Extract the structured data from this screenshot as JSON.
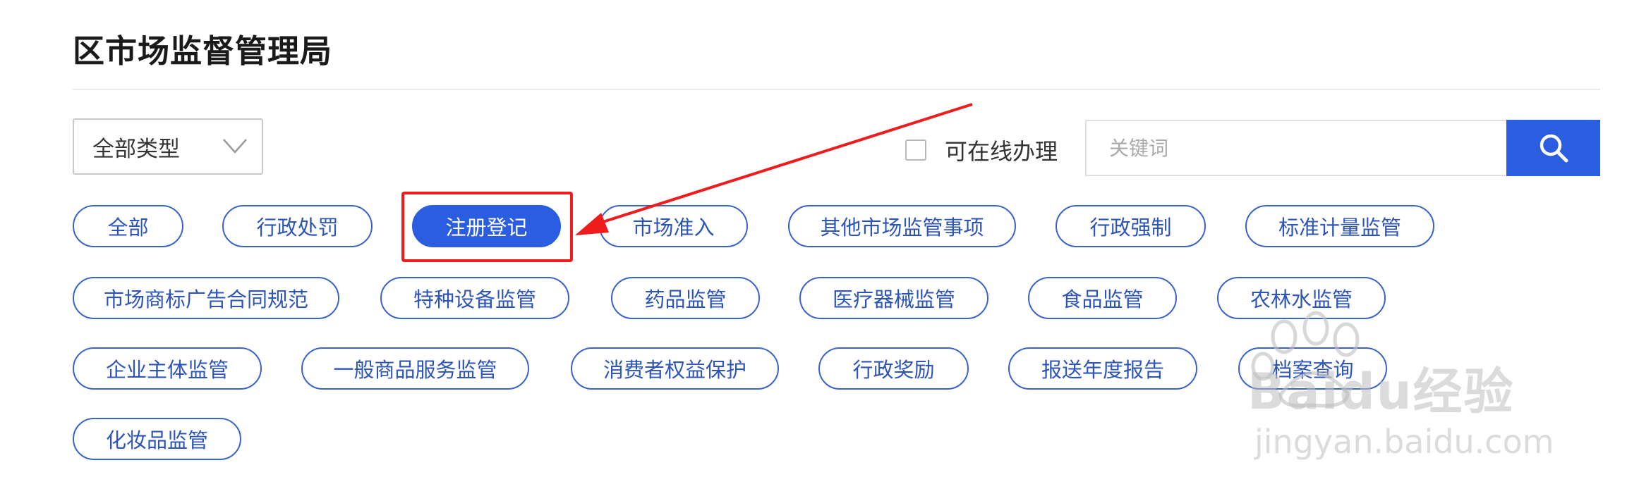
{
  "header": {
    "title": "区市场监督管理局"
  },
  "filters": {
    "type_select": {
      "value": "全部类型"
    },
    "online_checkbox": {
      "label": "可在线办理",
      "checked": false
    },
    "search": {
      "placeholder": "关键词"
    }
  },
  "categories": [
    {
      "label": "全部"
    },
    {
      "label": "行政处罚"
    },
    {
      "label": "注册登记",
      "active": true
    },
    {
      "label": "市场准入"
    },
    {
      "label": "其他市场监管事项"
    },
    {
      "label": "行政强制"
    },
    {
      "label": "标准计量监管"
    },
    {
      "label": "市场商标广告合同规范"
    },
    {
      "label": "特种设备监管"
    },
    {
      "label": "药品监管"
    },
    {
      "label": "医疗器械监管"
    },
    {
      "label": "食品监管"
    },
    {
      "label": "农林水监管"
    },
    {
      "label": "企业主体监管"
    },
    {
      "label": "一般商品服务监管"
    },
    {
      "label": "消费者权益保护"
    },
    {
      "label": "行政奖励"
    },
    {
      "label": "报送年度报告"
    },
    {
      "label": "档案查询"
    },
    {
      "label": "化妆品监管"
    }
  ],
  "watermark": {
    "brand": "Baidu经验",
    "url": "jingyan.baidu.com"
  },
  "colors": {
    "accent": "#2a5de0",
    "pill_border": "#3a63c9",
    "annotation": "#ee1c1c"
  },
  "icons": {
    "search_button": "search-icon",
    "select": "chevron-down-icon"
  }
}
